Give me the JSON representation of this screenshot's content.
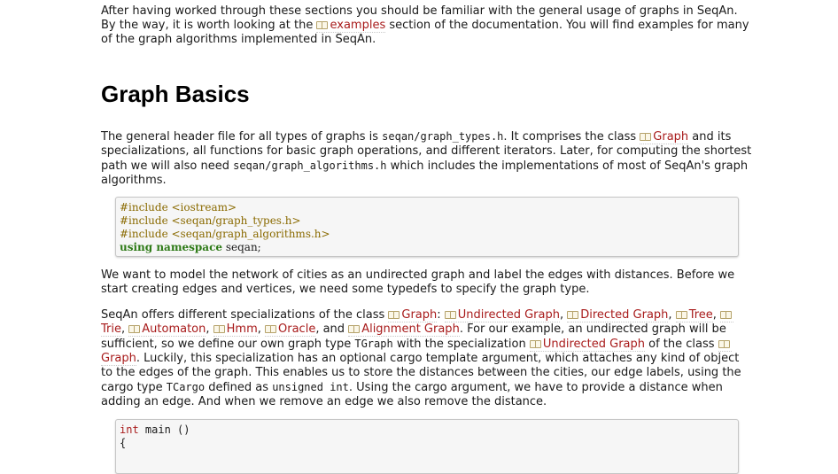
{
  "intro": {
    "before_link": "After having worked through these sections you should be familiar with the general usage of graphs in SeqAn. By the way, it is worth looking at the ",
    "link": "examples",
    "after_link": " section of the documentation. You will find examples for many of the graph algorithms implemented in SeqAn."
  },
  "heading": "Graph Basics",
  "para_header": {
    "t1": "The general header file for all types of graphs is ",
    "code1": "seqan/graph_types.h",
    "t2": ". It comprises the class ",
    "link_graph": "Graph",
    "t3": " and its specializations, all functions for basic graph operations, and different iterators. Later, for computing the shortest path we will also need ",
    "code2": "seqan/graph_algorithms.h",
    "t4": " which includes the implementations of most of SeqAn's graph algorithms."
  },
  "code1": {
    "line1": "#include <iostream>",
    "line2": "#include <seqan/graph_types.h>",
    "line3": "#include <seqan/graph_algorithms.h>",
    "line4_kw": "using namespace",
    "line4_rest": " seqan;"
  },
  "para_model": "We want to model the network of cities as an undirected graph and label the edges with distances. Before we start creating edges and vertices, we need some typedefs to specify the graph type.",
  "para_spec": {
    "t1": "SeqAn offers different specializations of the class ",
    "l_graph": "Graph",
    "t2": ": ",
    "l_undirected": "Undirected Graph",
    "l_directed": "Directed Graph",
    "l_tree": "Tree",
    "l_trie": "Trie",
    "l_automaton": "Automaton",
    "l_hmm": "Hmm",
    "l_oracle": "Oracle",
    "t_and": ", and ",
    "l_alignment": "Alignment Graph",
    "t3": ". For our example, an undirected graph will be sufficient, so we define our own graph type ",
    "code_tgraph": "TGraph",
    "t4": " with the specialization ",
    "l_undirected2": "Undirected Graph",
    "t5": " of the class ",
    "l_graph2": "Graph",
    "t6": ". Luckily, this specialization has an optional cargo template argument, which attaches any kind of object to the edges of the graph. This enables us to store the distances between the cities, our edge labels, using the cargo type ",
    "code_tcargo": "TCargo",
    "t7": " defined as ",
    "code_unsigned": "unsigned int",
    "t8": ". Using the cargo argument, we have to provide a distance when adding an edge. And when we remove an edge we also remove the distance."
  },
  "code2": {
    "kw_int": "int",
    "line1_rest": " main ()",
    "line2": "{"
  }
}
